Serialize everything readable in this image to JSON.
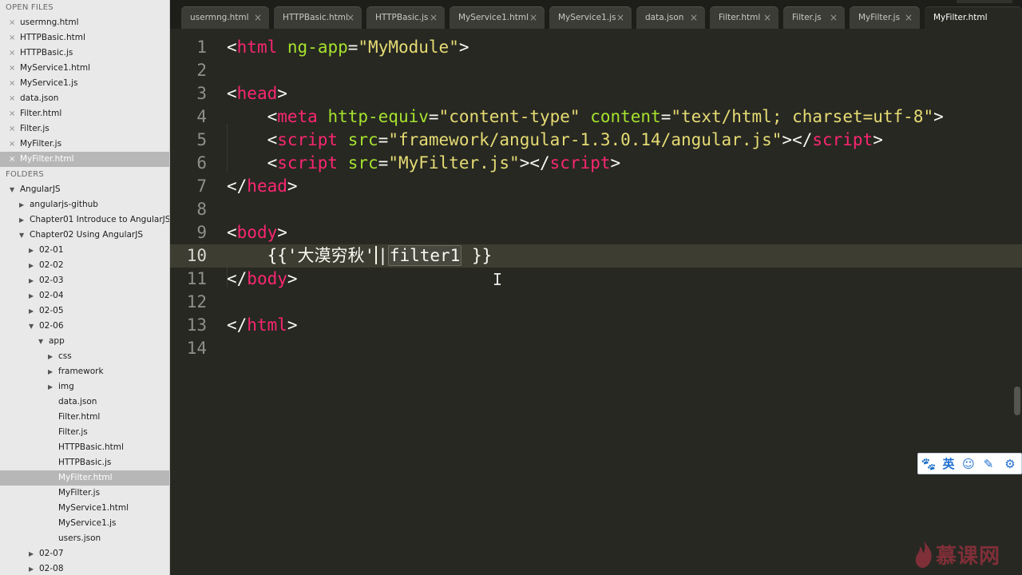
{
  "sidebar": {
    "open_files_header": "OPEN FILES",
    "open_files": [
      {
        "label": "usermng.html",
        "close": "×"
      },
      {
        "label": "HTTPBasic.html",
        "close": "×"
      },
      {
        "label": "HTTPBasic.js",
        "close": "×"
      },
      {
        "label": "MyService1.html",
        "close": "×"
      },
      {
        "label": "MyService1.js",
        "close": "×"
      },
      {
        "label": "data.json",
        "close": "×"
      },
      {
        "label": "Filter.html",
        "close": "×"
      },
      {
        "label": "Filter.js",
        "close": "×"
      },
      {
        "label": "MyFilter.js",
        "close": "×"
      },
      {
        "label": "MyFilter.html",
        "close": "×",
        "selected": true
      }
    ],
    "folders_header": "FOLDERS",
    "folders": [
      {
        "label": "AngularJS",
        "depth": 0,
        "expanded": true,
        "type": "folder"
      },
      {
        "label": "angularjs-github",
        "depth": 1,
        "expanded": false,
        "type": "folder"
      },
      {
        "label": "Chapter01 Introduce to AngularJS",
        "depth": 1,
        "expanded": false,
        "type": "folder"
      },
      {
        "label": "Chapter02 Using AngularJS",
        "depth": 1,
        "expanded": true,
        "type": "folder"
      },
      {
        "label": "02-01",
        "depth": 2,
        "expanded": false,
        "type": "folder"
      },
      {
        "label": "02-02",
        "depth": 2,
        "expanded": false,
        "type": "folder"
      },
      {
        "label": "02-03",
        "depth": 2,
        "expanded": false,
        "type": "folder"
      },
      {
        "label": "02-04",
        "depth": 2,
        "expanded": false,
        "type": "folder"
      },
      {
        "label": "02-05",
        "depth": 2,
        "expanded": false,
        "type": "folder"
      },
      {
        "label": "02-06",
        "depth": 2,
        "expanded": true,
        "type": "folder"
      },
      {
        "label": "app",
        "depth": 3,
        "expanded": true,
        "type": "folder"
      },
      {
        "label": "css",
        "depth": 4,
        "expanded": false,
        "type": "folder"
      },
      {
        "label": "framework",
        "depth": 4,
        "expanded": false,
        "type": "folder"
      },
      {
        "label": "img",
        "depth": 4,
        "expanded": false,
        "type": "folder"
      },
      {
        "label": "data.json",
        "depth": 4,
        "type": "file"
      },
      {
        "label": "Filter.html",
        "depth": 4,
        "type": "file"
      },
      {
        "label": "Filter.js",
        "depth": 4,
        "type": "file"
      },
      {
        "label": "HTTPBasic.html",
        "depth": 4,
        "type": "file"
      },
      {
        "label": "HTTPBasic.js",
        "depth": 4,
        "type": "file"
      },
      {
        "label": "MyFilter.html",
        "depth": 4,
        "type": "file",
        "selected": true
      },
      {
        "label": "MyFilter.js",
        "depth": 4,
        "type": "file"
      },
      {
        "label": "MyService1.html",
        "depth": 4,
        "type": "file"
      },
      {
        "label": "MyService1.js",
        "depth": 4,
        "type": "file"
      },
      {
        "label": "users.json",
        "depth": 4,
        "type": "file"
      },
      {
        "label": "02-07",
        "depth": 2,
        "expanded": false,
        "type": "folder"
      },
      {
        "label": "02-08",
        "depth": 2,
        "expanded": false,
        "type": "folder"
      }
    ]
  },
  "tabs": [
    {
      "label": "usermng.html",
      "close": "×"
    },
    {
      "label": "HTTPBasic.html",
      "close": "×"
    },
    {
      "label": "HTTPBasic.js",
      "close": "×"
    },
    {
      "label": "MyService1.html",
      "close": "×"
    },
    {
      "label": "MyService1.js",
      "close": "×"
    },
    {
      "label": "data.json",
      "close": "×"
    },
    {
      "label": "Filter.html",
      "close": "×"
    },
    {
      "label": "Filter.js",
      "close": "×"
    },
    {
      "label": "MyFilter.js",
      "close": "×"
    },
    {
      "label": "MyFilter.html",
      "close": "",
      "active": true
    }
  ],
  "editor": {
    "current_line": 10,
    "lines": [
      {
        "num": "1",
        "tokens": [
          [
            "punc",
            "<"
          ],
          [
            "tag",
            "html"
          ],
          [
            "punc",
            " "
          ],
          [
            "attr",
            "ng-app"
          ],
          [
            "punc",
            "="
          ],
          [
            "str",
            "\"MyModule\""
          ],
          [
            "punc",
            ">"
          ]
        ]
      },
      {
        "num": "2",
        "tokens": []
      },
      {
        "num": "3",
        "tokens": [
          [
            "punc",
            "<"
          ],
          [
            "tag",
            "head"
          ],
          [
            "punc",
            ">"
          ]
        ]
      },
      {
        "num": "4",
        "tokens": [
          [
            "punc",
            "    <"
          ],
          [
            "tag",
            "meta"
          ],
          [
            "punc",
            " "
          ],
          [
            "attr",
            "http-equiv"
          ],
          [
            "punc",
            "="
          ],
          [
            "str",
            "\"content-type\""
          ],
          [
            "punc",
            " "
          ],
          [
            "attr",
            "content"
          ],
          [
            "punc",
            "="
          ],
          [
            "str",
            "\"text/html; charset=utf-8\""
          ],
          [
            "punc",
            ">"
          ]
        ]
      },
      {
        "num": "5",
        "tokens": [
          [
            "punc",
            "    <"
          ],
          [
            "tag",
            "script"
          ],
          [
            "punc",
            " "
          ],
          [
            "attr",
            "src"
          ],
          [
            "punc",
            "="
          ],
          [
            "str",
            "\"framework/angular-1.3.0.14/angular.js\""
          ],
          [
            "punc",
            "></"
          ],
          [
            "tag",
            "script"
          ],
          [
            "punc",
            ">"
          ]
        ]
      },
      {
        "num": "6",
        "tokens": [
          [
            "punc",
            "    <"
          ],
          [
            "tag",
            "script"
          ],
          [
            "punc",
            " "
          ],
          [
            "attr",
            "src"
          ],
          [
            "punc",
            "="
          ],
          [
            "str",
            "\"MyFilter.js\""
          ],
          [
            "punc",
            "></"
          ],
          [
            "tag",
            "script"
          ],
          [
            "punc",
            ">"
          ]
        ]
      },
      {
        "num": "7",
        "tokens": [
          [
            "punc",
            "</"
          ],
          [
            "tag",
            "head"
          ],
          [
            "punc",
            ">"
          ]
        ]
      },
      {
        "num": "8",
        "tokens": []
      },
      {
        "num": "9",
        "tokens": [
          [
            "punc",
            "<"
          ],
          [
            "tag",
            "body"
          ],
          [
            "punc",
            ">"
          ]
        ]
      },
      {
        "num": "10",
        "tokens": [
          [
            "text",
            "    {{'大漠穷秋'"
          ],
          [
            "caret",
            ""
          ],
          [
            "text",
            "|"
          ],
          [
            "sel",
            "filter1"
          ],
          [
            "text",
            " }}"
          ]
        ]
      },
      {
        "num": "11",
        "tokens": [
          [
            "punc",
            "</"
          ],
          [
            "tag",
            "body"
          ],
          [
            "punc",
            ">"
          ]
        ]
      },
      {
        "num": "12",
        "tokens": []
      },
      {
        "num": "13",
        "tokens": [
          [
            "punc",
            "</"
          ],
          [
            "tag",
            "html"
          ],
          [
            "punc",
            ">"
          ]
        ]
      },
      {
        "num": "14",
        "tokens": []
      }
    ]
  },
  "cursor_glyph": "I",
  "ime_toolbar": {
    "buttons": [
      {
        "name": "paw-icon",
        "glyph": "🐾"
      },
      {
        "name": "ime-mode-english",
        "glyph": "英"
      },
      {
        "name": "smiley-icon",
        "glyph": "☺"
      },
      {
        "name": "pen-icon",
        "glyph": "✎"
      },
      {
        "name": "gear-icon",
        "glyph": "⚙"
      }
    ]
  },
  "watermark": {
    "text": "慕课网"
  },
  "colors": {
    "editor_bg": "#272822",
    "tag": "#f92672",
    "attr": "#a6e22e",
    "string": "#e6db74",
    "text": "#f8f8f2",
    "gutter": "#8f908a"
  }
}
